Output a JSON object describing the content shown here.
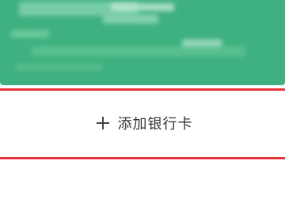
{
  "card": {
    "color": "#3fb07f",
    "obscured": true
  },
  "add_bank_card": {
    "label": "添加银行卡",
    "icon": "plus-icon",
    "highlight_color": "#e8333a"
  }
}
